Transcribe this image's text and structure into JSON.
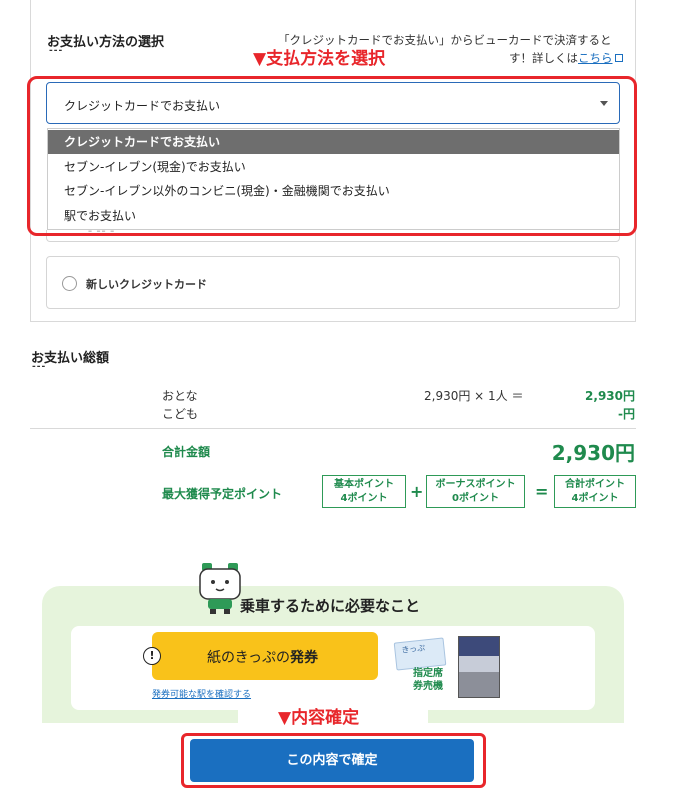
{
  "payment": {
    "section_title": "お支払い方法の選択",
    "title_dash": "---",
    "note_line1": "「クレジットカードでお支払い」からビューカードで決済すると",
    "note_line2": "す！詳しくは",
    "note_link": "こちら",
    "instruction": "▼支払方法を選択",
    "select_value": "クレジットカードでお支払い",
    "options": [
      "クレジットカードでお支払い",
      "セブン‐イレブン(現金)でお支払い",
      "セブン‐イレブン以外のコンビニ(現金)・金融機関でお支払い",
      "駅でお支払い"
    ],
    "hidden_peek": "ｰ ｰｰ ｰ",
    "new_card_label": "新しいクレジットカード"
  },
  "summary": {
    "title": "お支払い総額",
    "title_dash": "---",
    "adult_label": "おとな",
    "child_label": "こども",
    "calc": "2,930円 × 1人 ＝",
    "adult_amount": "2,930円",
    "child_amount": "-円",
    "total_label": "合計金額",
    "total_amount": "2,930円",
    "points_label": "最大獲得予定ポイント",
    "basic_point_title": "基本ポイント",
    "basic_point_value": "4ポイント",
    "bonus_point_title": "ボーナスポイント",
    "bonus_point_value": "0ポイント",
    "total_point_title": "合計ポイント",
    "total_point_value": "4ポイント",
    "plus": "+",
    "equals": "="
  },
  "boarding": {
    "title": "乗車するために必要なこと",
    "ticket_prefix": "紙のきっぷの",
    "ticket_bold": "発券",
    "issue_link": "発券可能な駅を確認する",
    "ticket_img_text": "きっぷ",
    "machine_label_1": "指定席",
    "machine_label_2": "券売機"
  },
  "confirm": {
    "instruction": "▼内容確定",
    "button_label": "この内容で確定"
  },
  "colors": {
    "accent_red": "#e8262b",
    "brand_green": "#1f8a4d",
    "button_blue": "#1a6fc0",
    "ticket_yellow": "#f9c21a"
  }
}
